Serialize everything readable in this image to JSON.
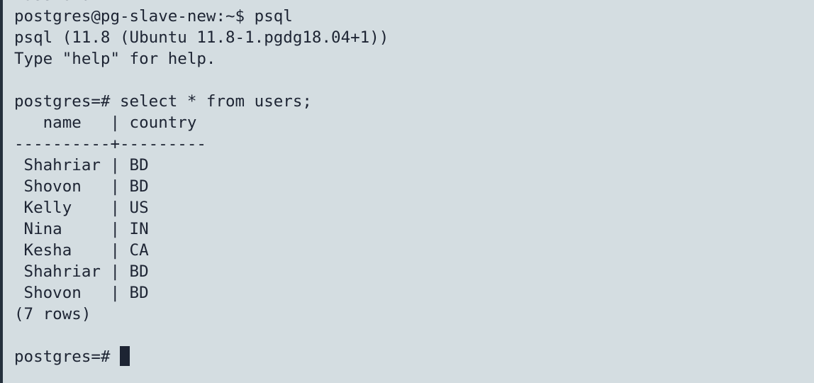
{
  "terminal": {
    "lines": [
      "Password:",
      "postgres@pg-slave-new:~$ psql",
      "psql (11.8 (Ubuntu 11.8-1.pgdg18.04+1))",
      "Type \"help\" for help.",
      "",
      "postgres=# select * from users;",
      "   name   | country",
      "----------+---------",
      " Shahriar | BD",
      " Shovon   | BD",
      " Kelly    | US",
      " Nina     | IN",
      " Kesha    | CA",
      " Shahriar | BD",
      " Shovon   | BD",
      "(7 rows)",
      ""
    ],
    "prompt": "postgres=# "
  }
}
